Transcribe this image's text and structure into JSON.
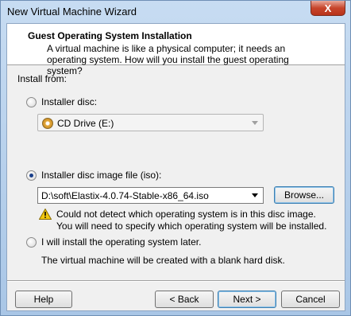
{
  "window": {
    "title": "New Virtual Machine Wizard",
    "close_glyph": "X"
  },
  "header": {
    "title": "Guest Operating System Installation",
    "description": "A virtual machine is like a physical computer; it needs an operating system. How will you install the guest operating system?"
  },
  "install_from": {
    "label": "Install from:",
    "installer_disc": {
      "label": "Installer disc:",
      "selected": false,
      "drive_value": "CD Drive (E:)"
    },
    "disc_image": {
      "label": "Installer disc image file (iso):",
      "selected": true,
      "path_value": "D:\\soft\\Elastix-4.0.74-Stable-x86_64.iso",
      "browse_label": "Browse...",
      "warning_line1": "Could not detect which operating system is in this disc image.",
      "warning_line2": "You will need to specify which operating system will be installed."
    },
    "install_later": {
      "label": "I will install the operating system later.",
      "selected": false,
      "note": "The virtual machine will be created with a blank hard disk."
    }
  },
  "footer": {
    "help_label": "Help",
    "back_label": "< Back",
    "next_label": "Next >",
    "cancel_label": "Cancel"
  },
  "colors": {
    "accent": "#3c7fb1",
    "window_frame": "#b9d1ea",
    "warning": "#f2c811"
  }
}
